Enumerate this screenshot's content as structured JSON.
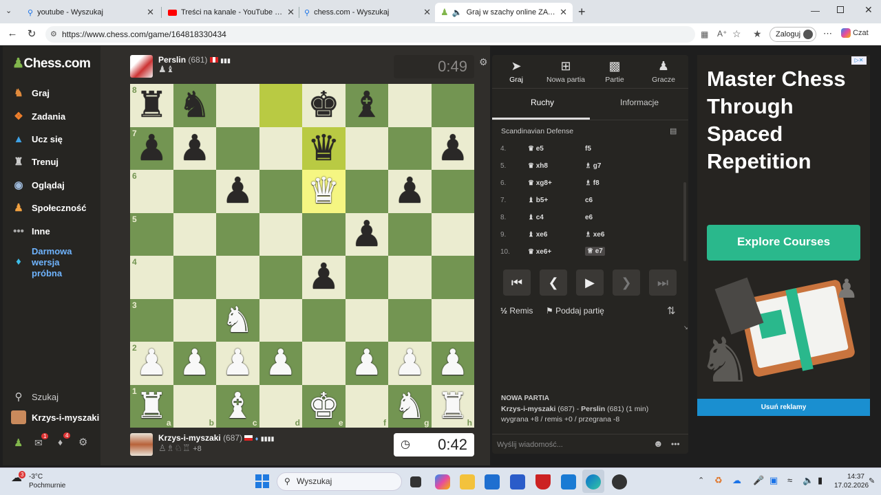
{
  "browser": {
    "tabs": [
      {
        "title": "youtube - Wyszukaj",
        "icon": "search-icon",
        "color": "#1a73e8"
      },
      {
        "title": "Treści na kanale - YouTube Studio",
        "icon": "youtube-icon",
        "color": "#ff0000"
      },
      {
        "title": "chess.com - Wyszukaj",
        "icon": "search-icon",
        "color": "#1a73e8"
      },
      {
        "title": "Graj w szachy online ZA DARMO",
        "icon": "chess-icon",
        "color": "#81b64c"
      }
    ],
    "url": "https://www.chess.com/game/164818330434",
    "login_label": "Zaloguj",
    "copilot_label": "Czat"
  },
  "sidebar": {
    "logo_text": "Chess.com",
    "items": [
      {
        "label": "Graj",
        "icon": "play-icon"
      },
      {
        "label": "Zadania",
        "icon": "puzzle-icon"
      },
      {
        "label": "Ucz się",
        "icon": "learn-icon"
      },
      {
        "label": "Trenuj",
        "icon": "train-icon"
      },
      {
        "label": "Oglądaj",
        "icon": "watch-icon"
      },
      {
        "label": "Społeczność",
        "icon": "community-icon"
      },
      {
        "label": "Inne",
        "icon": "more-icon"
      },
      {
        "label": "Darmowa wersja próbna",
        "icon": "diamond-icon"
      }
    ],
    "search_label": "Szukaj",
    "user_label": "Krzys-i-myszaki",
    "mail_badge": "1",
    "notif_badge": "4"
  },
  "game": {
    "top_player": {
      "name": "Perslin",
      "rating": "(681)",
      "clock": "0:49",
      "captured": "♟♝"
    },
    "bottom_player": {
      "name": "Krzys-i-myszaki",
      "rating": "(687)",
      "clock": "0:42",
      "captured": "♙♗♘♖",
      "advantage": "+8"
    },
    "rank_labels": [
      "8",
      "7",
      "6",
      "5",
      "4",
      "3",
      "2",
      "1"
    ],
    "file_labels": [
      "a",
      "b",
      "c",
      "d",
      "e",
      "f",
      "g",
      "h"
    ],
    "board": [
      [
        "br",
        "bn",
        "",
        "",
        "bk",
        "bb",
        "",
        ""
      ],
      [
        "bp",
        "bp",
        "",
        "",
        "bq",
        "",
        "",
        "bp"
      ],
      [
        "",
        "",
        "bp",
        "",
        "wq",
        "",
        "bp",
        ""
      ],
      [
        "",
        "",
        "",
        "",
        "",
        "bp",
        "",
        ""
      ],
      [
        "",
        "",
        "",
        "",
        "bp",
        "",
        "",
        ""
      ],
      [
        "",
        "",
        "wn",
        "",
        "",
        "",
        "",
        ""
      ],
      [
        "wp",
        "wp",
        "wp",
        "wp",
        "",
        "wp",
        "wp",
        "wp"
      ],
      [
        "wr",
        "",
        "wb",
        "",
        "wk",
        "",
        "wn",
        "wr"
      ]
    ],
    "highlights": [
      [
        0,
        3
      ],
      [
        1,
        4
      ],
      [
        2,
        4
      ]
    ]
  },
  "panel": {
    "tabs": [
      {
        "label": "Graj",
        "icon": "rocket-icon"
      },
      {
        "label": "Nowa partia",
        "icon": "plus-icon"
      },
      {
        "label": "Partie",
        "icon": "grid-icon"
      },
      {
        "label": "Gracze",
        "icon": "players-icon"
      }
    ],
    "subtabs": {
      "moves": "Ruchy",
      "info": "Informacje"
    },
    "opening": "Scandinavian Defense",
    "moves": [
      {
        "n": "4.",
        "w": "e5",
        "wp": "♛",
        "b": "f5",
        "bp": ""
      },
      {
        "n": "5.",
        "w": "xh8",
        "wp": "♛",
        "b": "g7",
        "bp": "♗"
      },
      {
        "n": "6.",
        "w": "xg8+",
        "wp": "♛",
        "b": "f8",
        "bp": "♗"
      },
      {
        "n": "7.",
        "w": "b5+",
        "wp": "♝",
        "b": "c6",
        "bp": ""
      },
      {
        "n": "8.",
        "w": "c4",
        "wp": "♝",
        "b": "e6",
        "bp": ""
      },
      {
        "n": "9.",
        "w": "xe6",
        "wp": "♝",
        "b": "xe6",
        "bp": "♗"
      },
      {
        "n": "10.",
        "w": "xe6+",
        "wp": "♛",
        "b": "e7",
        "bp": "♕"
      }
    ],
    "draw_label": "Remis",
    "resign_label": "Poddaj partię",
    "new_game_heading": "NOWA PARTIA",
    "new_game_white": "Krzys-i-myszaki",
    "new_game_white_rating": "(687)",
    "new_game_black": "Perslin",
    "new_game_black_rating": "(681) (1 min)",
    "result_line": "wygrana +8 / remis +0 / przegrana -8",
    "chat_placeholder": "Wyślij wiadomość..."
  },
  "ad": {
    "title": "Master Chess Through Spaced Repetition",
    "button": "Explore Courses",
    "remove": "Usuń reklamy"
  },
  "taskbar": {
    "weather_temp": "-3°C",
    "weather_desc": "Pochmurnie",
    "weather_badge": "3",
    "search_label": "Wyszukaj",
    "time": "14:37",
    "date": "17.02.2026"
  }
}
